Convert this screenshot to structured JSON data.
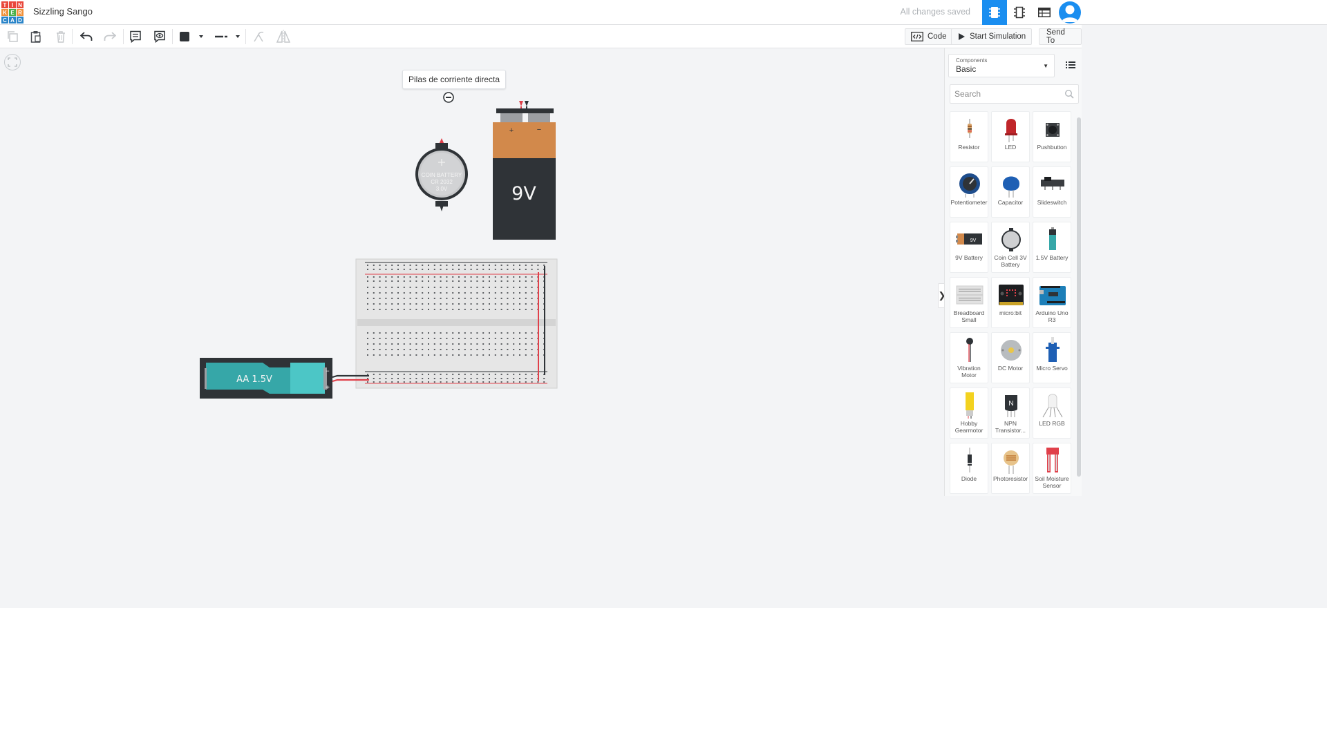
{
  "app": {
    "project_title": "Sizzling Sango",
    "save_status": "All changes saved",
    "logo_letters": [
      "T",
      "I",
      "N",
      "K",
      "E",
      "R",
      "C",
      "A",
      "D"
    ]
  },
  "toolbar": {
    "code_label": "Code",
    "start_simulation_label": "Start Simulation",
    "send_to_label": "Send To"
  },
  "canvas": {
    "tooltip_text": "Pilas de corriente directa",
    "coin_battery_lines": [
      "COIN BATTERY",
      "CR 2032",
      "3.0V"
    ],
    "battery_9v_label": "9V",
    "battery_aa_label": "AA 1.5V"
  },
  "panel": {
    "category_caption": "Components",
    "category_value": "Basic",
    "search_placeholder": "Search",
    "components": [
      {
        "label": "Resistor"
      },
      {
        "label": "LED"
      },
      {
        "label": "Pushbutton"
      },
      {
        "label": "Potentiometer"
      },
      {
        "label": "Capacitor"
      },
      {
        "label": "Slideswitch"
      },
      {
        "label": "9V Battery"
      },
      {
        "label": "Coin Cell 3V Battery"
      },
      {
        "label": "1.5V Battery"
      },
      {
        "label": "Breadboard Small"
      },
      {
        "label": "micro:bit"
      },
      {
        "label": "Arduino Uno R3"
      },
      {
        "label": "Vibration Motor"
      },
      {
        "label": "DC Motor"
      },
      {
        "label": "Micro Servo"
      },
      {
        "label": "Hobby Gearmotor"
      },
      {
        "label": "NPN Transistor..."
      },
      {
        "label": "LED RGB"
      },
      {
        "label": "Diode"
      },
      {
        "label": "Photoresistor"
      },
      {
        "label": "Soil Moisture Sensor"
      }
    ]
  },
  "colors": {
    "accent": "#1a8ef0",
    "logo_red": "#e9473b",
    "logo_orange": "#f0913a",
    "logo_blue": "#2a84c8",
    "logo_green": "#4ab04a"
  }
}
